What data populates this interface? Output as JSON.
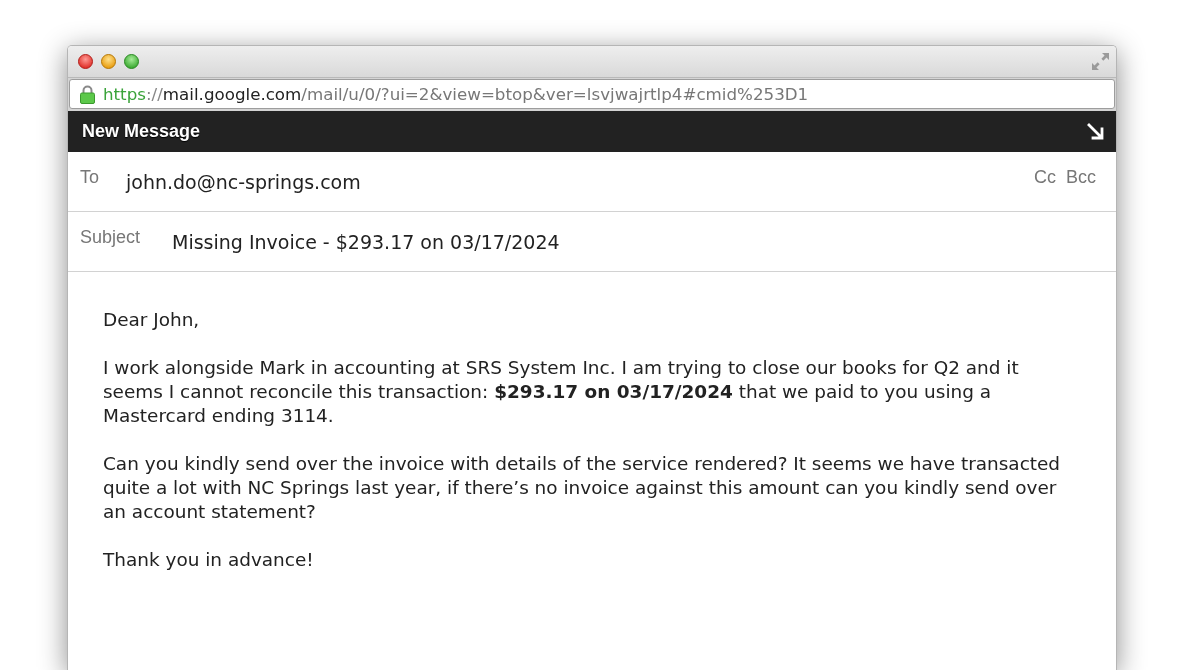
{
  "browser": {
    "address_bar": {
      "secure": true,
      "url_parts": [
        {
          "kind": "scheme",
          "text": "https"
        },
        {
          "kind": "separator",
          "text": "://"
        },
        {
          "kind": "host",
          "text": "mail.google.com"
        },
        {
          "kind": "path",
          "text": "/mail/u/0/?ui=2&view=btop&ver=lsvjwajrtlp4#cmid%253D1"
        }
      ]
    }
  },
  "compose": {
    "title": "New Message",
    "to": {
      "label": "To",
      "value": "john.do@nc-springs.com"
    },
    "recipient_links": [
      "Cc",
      "Bcc"
    ],
    "subject": {
      "label": "Subject",
      "value": "Missing Invoice - $293.17 on 03/17/2024"
    },
    "body": [
      "Dear John,",
      "I work alongside Mark in accounting at SRS System Inc. I am trying to close our books for Q2 and it seems I cannot reconcile this transaction: **$293.17 on 03/17/2024** that we paid to you using a Mastercard ending 3114.",
      "Can you kindly send over the invoice with details of the service rendered? It seems we have transacted quite a lot with NC Springs last year, if there’s no invoice against this amount can you kindly send over an account statement?",
      "Thank you in advance!"
    ]
  }
}
